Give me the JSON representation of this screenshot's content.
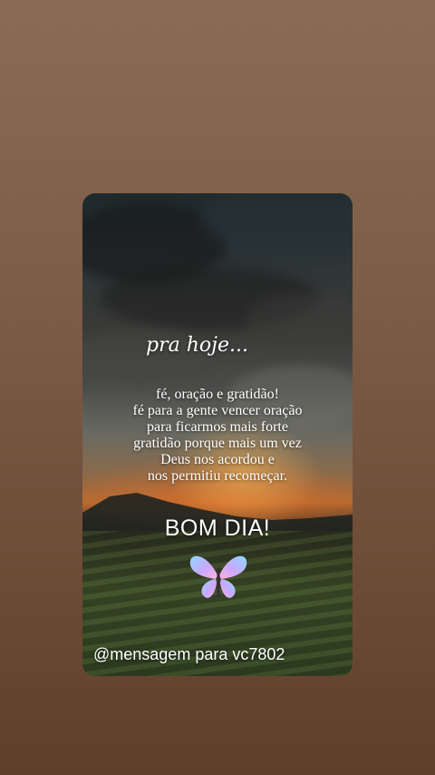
{
  "post": {
    "heading": "pra hoje...",
    "body_lines": [
      "fé, oração e gratidão!",
      "fé para a gente vencer oração",
      "para ficarmos mais forte",
      "gratidão porque mais um vez",
      "Deus nos acordou e",
      "nos permitiu recomeçar."
    ],
    "greeting": "BOM DIA!",
    "decoration_icon": "butterfly-icon",
    "handle": "@mensagem para vc7802"
  },
  "colors": {
    "background": "#7d5e48",
    "text": "#ffffff",
    "sunset": "#b86a30"
  }
}
